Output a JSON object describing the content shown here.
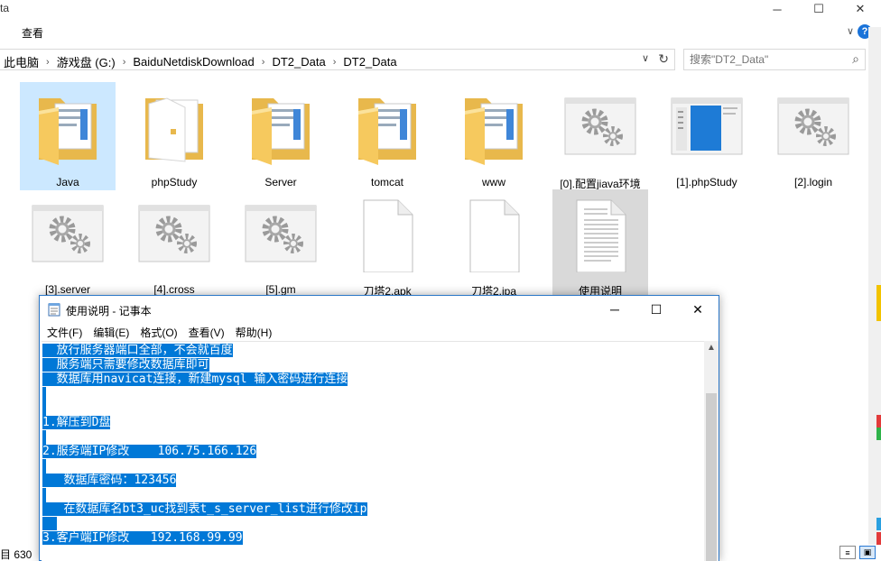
{
  "explorer": {
    "title": "ta",
    "window_buttons": {
      "minimize": "─",
      "maximize": "☐",
      "close": "✕"
    },
    "ribbon": {
      "view_tab": "查看",
      "expand": "∨",
      "help": "?"
    },
    "address": {
      "crumbs": [
        "此电脑",
        "游戏盘 (G:)",
        "BaiduNetdiskDownload",
        "DT2_Data",
        "DT2_Data"
      ],
      "separator": "›",
      "dropdown": "∨",
      "refresh": "↻"
    },
    "search": {
      "placeholder": "搜索\"DT2_Data\"",
      "icon": "⌕"
    },
    "items": [
      {
        "label": "Java",
        "kind": "folder"
      },
      {
        "label": "phpStudy",
        "kind": "folder-open"
      },
      {
        "label": "Server",
        "kind": "folder"
      },
      {
        "label": "tomcat",
        "kind": "folder"
      },
      {
        "label": "www",
        "kind": "folder"
      },
      {
        "label": "[0].配置jiava环境",
        "kind": "gear"
      },
      {
        "label": "[1].phpStudy",
        "kind": "app"
      },
      {
        "label": "[2].login",
        "kind": "gear"
      },
      {
        "label": "[3].server",
        "kind": "gear"
      },
      {
        "label": "[4].cross",
        "kind": "gear"
      },
      {
        "label": "[5].gm",
        "kind": "gear"
      },
      {
        "label": "刀塔2.apk",
        "kind": "blank"
      },
      {
        "label": "刀塔2.ipa",
        "kind": "blank"
      },
      {
        "label": "使用说明",
        "kind": "text"
      }
    ],
    "status": {
      "count": "目 630"
    }
  },
  "notepad": {
    "title": "使用说明 - 记事本",
    "buttons": {
      "minimize": "─",
      "maximize": "☐",
      "close": "✕"
    },
    "menu": [
      "文件(F)",
      "编辑(E)",
      "格式(O)",
      "查看(V)",
      "帮助(H)"
    ],
    "lines": [
      "  放行服务器端口全部，不会就百度",
      "  服务端只需要修改数据库即可",
      "  数据库用navicat连接，新建mysql 输入密码进行连接",
      "",
      "",
      "1.解压到D盘",
      "",
      "2.服务端IP修改    106.75.166.126",
      "",
      "   数据库密码：123456",
      "",
      "   在数据库名bt3_uc找到表t_s_server_list进行修改ip",
      "  ",
      "3.客户端IP修改   192.168.99.99"
    ],
    "scroll_up": "▲"
  },
  "colors": {
    "selection": "#0078d7",
    "folder": "#f6c95e",
    "accent": "#2b77c8"
  }
}
